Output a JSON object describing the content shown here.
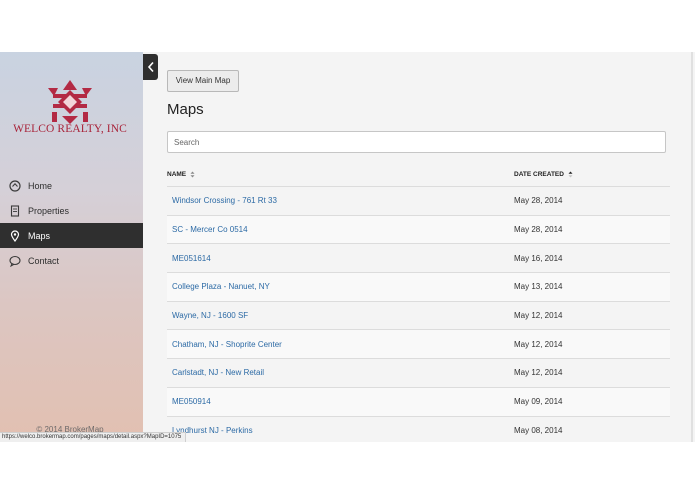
{
  "sidebar": {
    "logo_text": "WELCO REALTY, INC",
    "items": [
      {
        "label": "Home",
        "icon": "home-icon"
      },
      {
        "label": "Properties",
        "icon": "properties-icon"
      },
      {
        "label": "Maps",
        "icon": "map-pin-icon",
        "active": true
      },
      {
        "label": "Contact",
        "icon": "chat-icon"
      }
    ],
    "copyright": "© 2014 BrokerMap"
  },
  "toolbar": {
    "view_main_map_label": "View Main Map"
  },
  "main": {
    "title": "Maps"
  },
  "search": {
    "placeholder": "Search"
  },
  "table": {
    "columns": {
      "name": "NAME",
      "date": "DATE CREATED"
    },
    "rows": [
      {
        "name": "Windsor Crossing - 761 Rt 33",
        "date": "May 28, 2014"
      },
      {
        "name": "SC - Mercer Co 0514",
        "date": "May 28, 2014"
      },
      {
        "name": "ME051614",
        "date": "May 16, 2014"
      },
      {
        "name": "College Plaza - Nanuet, NY",
        "date": "May 13, 2014"
      },
      {
        "name": "Wayne, NJ - 1600 SF",
        "date": "May 12, 2014"
      },
      {
        "name": "Chatham, NJ - Shoprite Center",
        "date": "May 12, 2014"
      },
      {
        "name": "Carlstadt, NJ - New Retail",
        "date": "May 12, 2014"
      },
      {
        "name": "ME050914",
        "date": "May 09, 2014"
      },
      {
        "name": "Lyndhurst NJ - Perkins",
        "date": "May 08, 2014"
      }
    ]
  },
  "status_bar": {
    "url": "https://welco.brokermap.com/pages/maps/detail.aspx?MapID=1075"
  },
  "colors": {
    "brand": "#a8243a",
    "link": "#2c6aa5",
    "nav_active": "#2f2f2f"
  }
}
